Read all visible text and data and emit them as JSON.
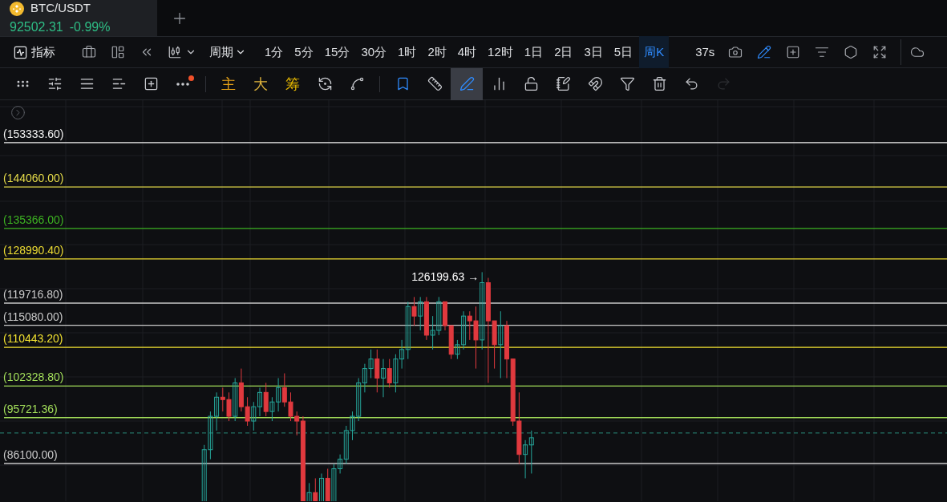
{
  "tab": {
    "symbol": "BTC/USDT",
    "price": "92502.31",
    "change": "-0.99%"
  },
  "toolbar": {
    "indicator_label": "指标",
    "period_label": "周期",
    "countdown": "37s",
    "intervals": [
      {
        "label": "1分",
        "selected": false
      },
      {
        "label": "5分",
        "selected": false
      },
      {
        "label": "15分",
        "selected": false
      },
      {
        "label": "30分",
        "selected": false
      },
      {
        "label": "1时",
        "selected": false
      },
      {
        "label": "2时",
        "selected": false
      },
      {
        "label": "4时",
        "selected": false
      },
      {
        "label": "12时",
        "selected": false
      },
      {
        "label": "1日",
        "selected": false
      },
      {
        "label": "2日",
        "selected": false
      },
      {
        "label": "3日",
        "selected": false
      },
      {
        "label": "5日",
        "selected": false
      },
      {
        "label": "周K",
        "selected": true
      }
    ]
  },
  "drawing_toolbar": {
    "tools": [
      {
        "kind": "horizontal-ray",
        "selected": false,
        "disabled": false
      },
      {
        "kind": "parallel",
        "selected": false,
        "disabled": false
      },
      {
        "kind": "lines",
        "selected": false,
        "disabled": false
      },
      {
        "kind": "checklist",
        "selected": false,
        "disabled": false
      },
      {
        "kind": "crosshair-box",
        "selected": false,
        "disabled": false
      },
      {
        "kind": "more",
        "selected": false,
        "disabled": false,
        "badge": true
      },
      {
        "kind": "divider"
      },
      {
        "kind": "text",
        "label": "主",
        "selected": false,
        "disabled": false
      },
      {
        "kind": "text",
        "label": "大",
        "selected": false,
        "disabled": false
      },
      {
        "kind": "text",
        "label": "筹",
        "selected": false,
        "disabled": false
      },
      {
        "kind": "swap",
        "selected": false,
        "disabled": false
      },
      {
        "kind": "trend",
        "selected": false,
        "disabled": false
      },
      {
        "kind": "divider"
      },
      {
        "kind": "bookmark",
        "selected": false,
        "disabled": false
      },
      {
        "kind": "ruler",
        "selected": false,
        "disabled": false
      },
      {
        "kind": "pen",
        "selected": true,
        "disabled": false
      },
      {
        "kind": "candles",
        "selected": false,
        "disabled": false
      },
      {
        "kind": "lock",
        "selected": false,
        "disabled": false
      },
      {
        "kind": "note",
        "selected": false,
        "disabled": false
      },
      {
        "kind": "magnet",
        "selected": false,
        "disabled": false
      },
      {
        "kind": "filter",
        "selected": false,
        "disabled": false
      },
      {
        "kind": "trash",
        "selected": false,
        "disabled": false
      },
      {
        "kind": "undo",
        "selected": false,
        "disabled": false
      },
      {
        "kind": "redo",
        "selected": false,
        "disabled": true
      }
    ]
  },
  "chart": {
    "peak_label": "126199.63 →",
    "levels": [
      {
        "label": "(153333.60)",
        "color": "#f2f2f2"
      },
      {
        "label": "(144060.00)",
        "color": "#e6dc4a"
      },
      {
        "label": "(135366.00)",
        "color": "#3db322"
      },
      {
        "label": "(128990.40)",
        "color": "#eedd33"
      },
      {
        "label": "(119716.80)",
        "color": "#c9c9c9"
      },
      {
        "label": "(115080.00)",
        "color": "#c9c9c9"
      },
      {
        "label": "(110443.20)",
        "color": "#f0e030"
      },
      {
        "label": "(102328.80)",
        "color": "#a3df5a"
      },
      {
        "label": "(95721.36)",
        "color": "#a3df5a"
      },
      {
        "label": "(86100.00)",
        "color": "#c9c9c9"
      }
    ]
  }
}
